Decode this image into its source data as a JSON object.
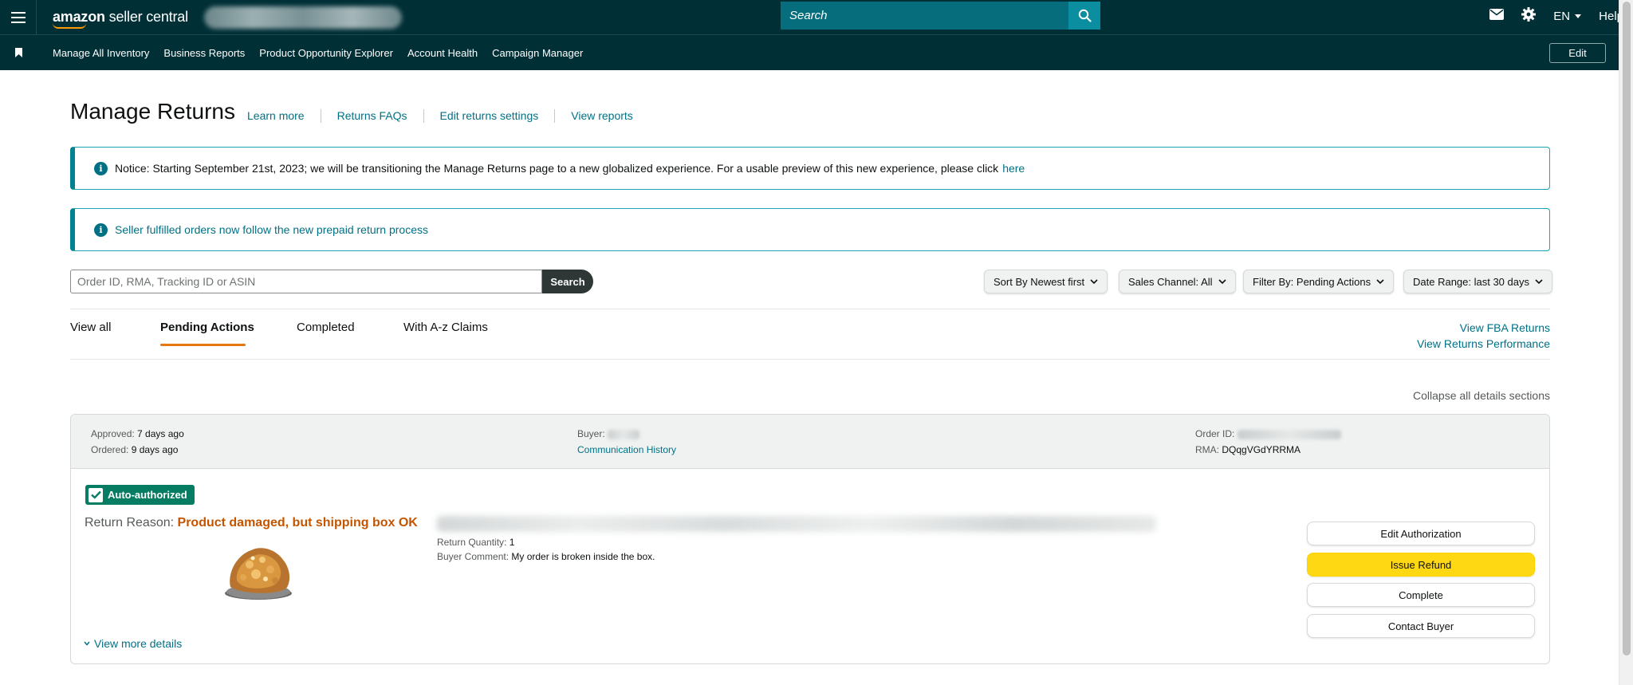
{
  "header": {
    "logo_main": "amazon",
    "logo_rest": "seller central",
    "search_placeholder": "Search",
    "language": "EN",
    "help": "Help"
  },
  "bookmarks": {
    "items": [
      "Manage All Inventory",
      "Business Reports",
      "Product Opportunity Explorer",
      "Account Health",
      "Campaign Manager"
    ],
    "edit_label": "Edit"
  },
  "page": {
    "title": "Manage Returns",
    "links": [
      "Learn more",
      "Returns FAQs",
      "Edit returns settings",
      "View reports"
    ]
  },
  "notices": {
    "first_text": "Notice: Starting September 21st, 2023; we will be transitioning the Manage Returns page to a new globalized experience. For a usable preview of this new experience, please click",
    "first_link": "here",
    "second_text": "Seller fulfilled orders now follow the new prepaid return process"
  },
  "search": {
    "placeholder": "Order ID, RMA, Tracking ID or ASIN",
    "button": "Search"
  },
  "filters": {
    "sort": "Sort By Newest first",
    "channel": "Sales Channel: All",
    "filter": "Filter By: Pending Actions",
    "date": "Date Range: last 30 days"
  },
  "tabs": {
    "view_all": "View all",
    "pending": "Pending Actions",
    "completed": "Completed",
    "claims": "With A-z Claims"
  },
  "side_links": {
    "fba": "View FBA Returns",
    "performance": "View Returns Performance",
    "collapse": "Collapse all details sections"
  },
  "return_card": {
    "approved_label": "Approved:",
    "approved_value": "7 days ago",
    "ordered_label": "Ordered:",
    "ordered_value": "9 days ago",
    "buyer_label": "Buyer:",
    "communication_link": "Communication History",
    "order_id_label": "Order ID:",
    "rma_label": "RMA:",
    "rma_value": "DQqgVGdYRRMA",
    "badge": "Auto-authorized",
    "reason_label": "Return Reason:",
    "reason_value": "Product damaged, but shipping box OK",
    "quantity_label": "Return Quantity:",
    "quantity_value": "1",
    "comment_label": "Buyer Comment:",
    "comment_value": "My order is broken inside the box.",
    "more_details": "View more details",
    "buttons": {
      "edit": "Edit Authorization",
      "refund": "Issue Refund",
      "complete": "Complete",
      "contact": "Contact Buyer"
    }
  },
  "colors": {
    "header_bg": "#002f36",
    "link": "#007185",
    "accent_orange": "#e47911",
    "reason": "#c45500",
    "badge_green": "#067d62",
    "primary_button": "#ffd814"
  }
}
